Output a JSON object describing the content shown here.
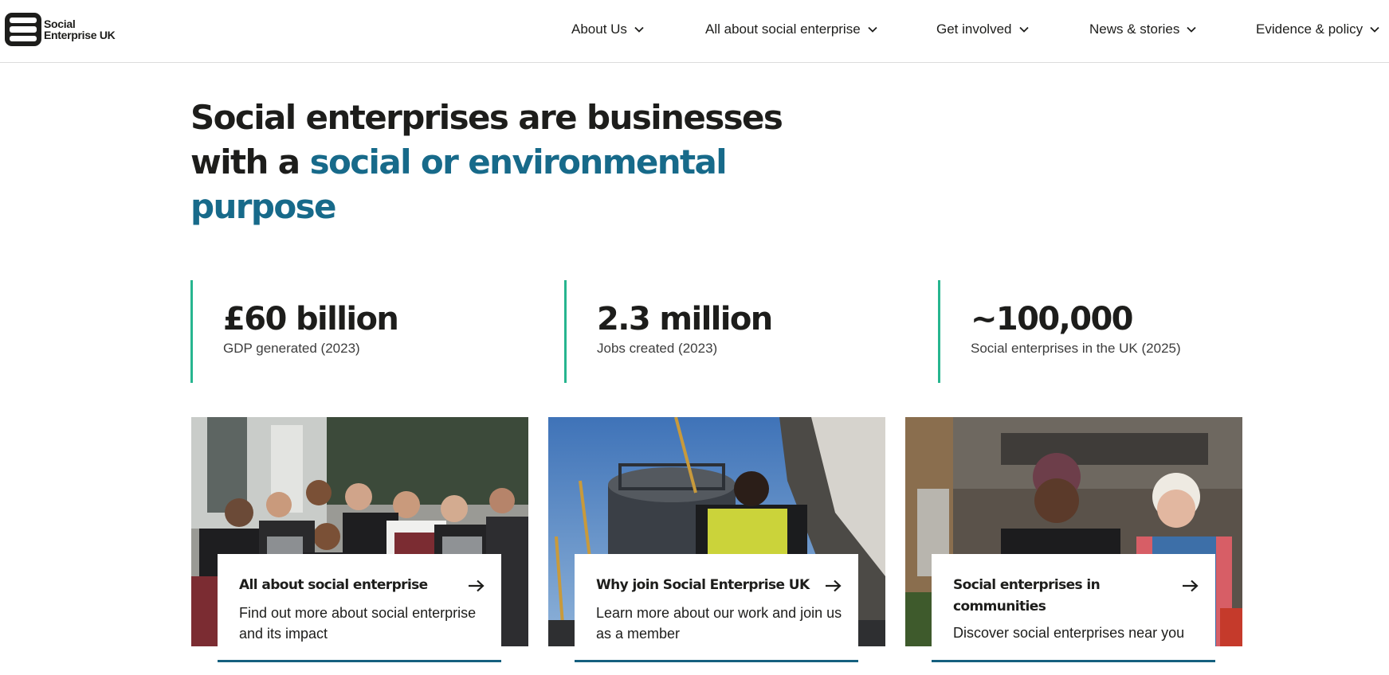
{
  "brand": {
    "name_line1": "Social",
    "name_line2": "Enterprise UK"
  },
  "nav": {
    "items": [
      {
        "label": "About Us",
        "icon": "chevron-down-icon"
      },
      {
        "label": "All about social enterprise",
        "icon": "chevron-down-icon"
      },
      {
        "label": "Get involved",
        "icon": "chevron-down-icon"
      },
      {
        "label": "News & stories",
        "icon": "chevron-down-icon"
      },
      {
        "label": "Evidence & policy",
        "icon": "chevron-down-icon"
      }
    ]
  },
  "hero": {
    "title_part1": "Social enterprises are businesses with a",
    "title_highlight": "social or environmental purpose"
  },
  "stats": [
    {
      "value": "£60 billion",
      "label": "GDP generated (2023)"
    },
    {
      "value": "2.3 million",
      "label": "Jobs created (2023)"
    },
    {
      "value": "~100,000",
      "label": "Social enterprises in the UK (2025)"
    }
  ],
  "cards": [
    {
      "title": "All about social enterprise",
      "description": "Find out more about social enterprise and its impact",
      "icon": "arrow-right-icon"
    },
    {
      "title": "Why join Social Enterprise UK",
      "description": "Learn more about our work and join us as a member",
      "icon": "arrow-right-icon"
    },
    {
      "title": "Social enterprises in communities",
      "description": "Discover social enterprises near you",
      "icon": "arrow-right-icon"
    }
  ],
  "colors": {
    "accent_blue": "#176a8a",
    "stat_rule_green": "#27b58f",
    "card_underline": "#15607f",
    "text": "#1d1d1b"
  }
}
